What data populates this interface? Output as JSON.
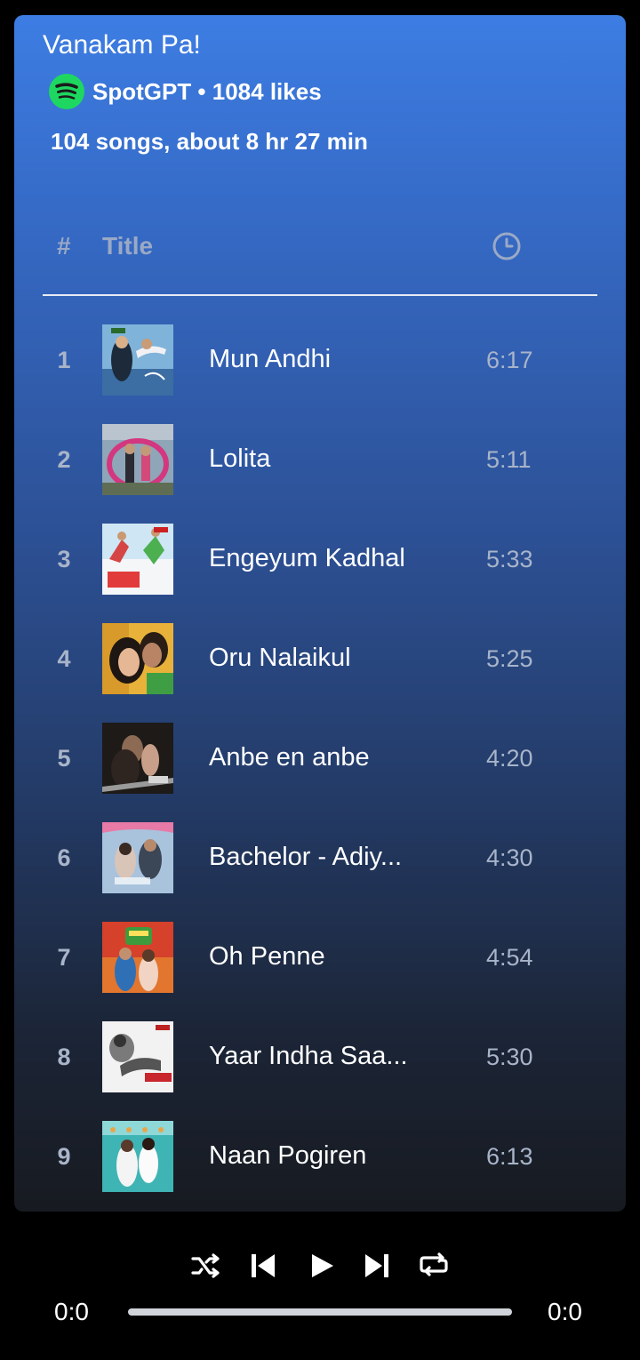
{
  "playlist": {
    "title": "Vanakam Pa!",
    "owner_line": "SpotGPT • 1084 likes",
    "stats": "104 songs, about 8 hr 27 min"
  },
  "table_header": {
    "number_label": "#",
    "title_label": "Title",
    "duration_icon": "clock-icon"
  },
  "tracks": [
    {
      "number": "1",
      "title": "Mun Andhi",
      "duration": "6:17"
    },
    {
      "number": "2",
      "title": "Lolita",
      "duration": "5:11"
    },
    {
      "number": "3",
      "title": "Engeyum Kadhal",
      "duration": "5:33"
    },
    {
      "number": "4",
      "title": "Oru Nalaikul",
      "duration": "5:25"
    },
    {
      "number": "5",
      "title": "Anbe en anbe",
      "duration": "4:20"
    },
    {
      "number": "6",
      "title": "Bachelor - Adiy...",
      "duration": "4:30"
    },
    {
      "number": "7",
      "title": "Oh Penne",
      "duration": "4:54"
    },
    {
      "number": "8",
      "title": "Yaar Indha Saa...",
      "duration": "5:30"
    },
    {
      "number": "9",
      "title": "Naan Pogiren",
      "duration": "6:13"
    }
  ],
  "player": {
    "controls": [
      "shuffle-icon",
      "previous-icon",
      "play-icon",
      "next-icon",
      "repeat-icon"
    ],
    "elapsed": "0:0",
    "total": "0:0",
    "progress": 0
  },
  "colors": {
    "spotify_green": "#1ed760",
    "gradient_top": "#3d7de3",
    "gradient_bottom": "#171a20"
  }
}
